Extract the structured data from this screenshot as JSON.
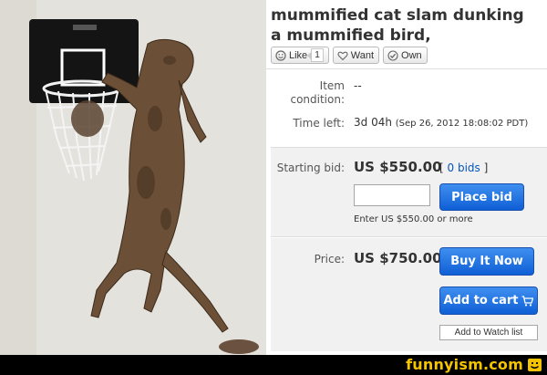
{
  "listing": {
    "title_line1": "mummified cat slam dunking",
    "title_line2": "a mummified bird,"
  },
  "social": {
    "like_label": "Like",
    "like_count": "1",
    "want_label": "Want",
    "own_label": "Own"
  },
  "details": {
    "condition_label_line1": "Item",
    "condition_label_line2": "condition:",
    "condition_value": "--",
    "time_left_label": "Time left:",
    "time_left_value": "3d 04h",
    "time_left_end": "(Sep 26, 2012  18:08:02 PDT)"
  },
  "bidding": {
    "starting_bid_label": "Starting bid:",
    "starting_bid_value": "US $550.00",
    "bids_open": "[",
    "bids_link": "0 bids",
    "bids_close": "]",
    "bid_input_value": "",
    "place_bid_label": "Place bid",
    "hint": "Enter US $550.00 or more"
  },
  "buy_now": {
    "price_label": "Price:",
    "price_value": "US $750.00",
    "buy_it_now_label": "Buy It Now",
    "add_to_cart_label": "Add to cart",
    "watch_label": "Add to Watch list"
  },
  "footer": {
    "brand": "funnyism.com"
  },
  "colors": {
    "button_blue": "#0f5fd6",
    "link_blue": "#0654ba",
    "brand_yellow": "#f5c400"
  },
  "icons": {
    "like": "smiley-icon",
    "want": "heart-icon",
    "own": "checkmark-icon",
    "cart": "cart-icon"
  }
}
